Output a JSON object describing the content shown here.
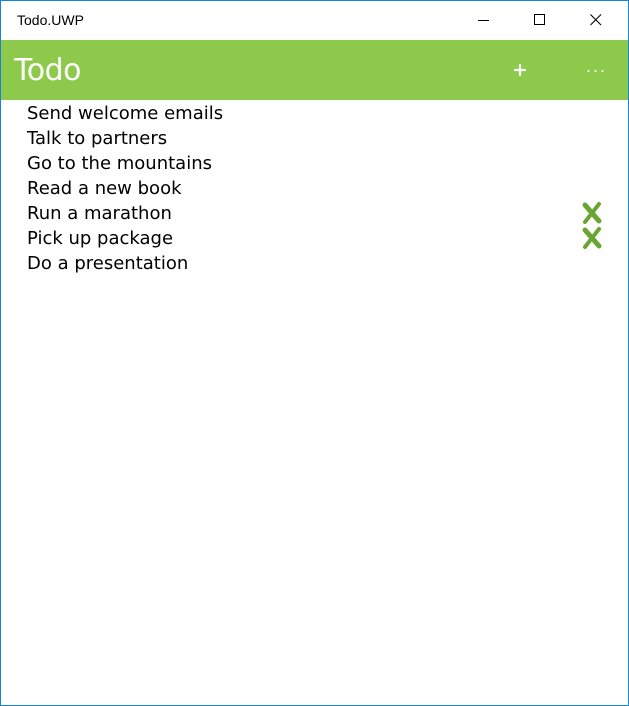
{
  "window": {
    "title": "Todo.UWP",
    "caption_buttons": [
      "minimize-icon",
      "maximize-icon",
      "close-icon"
    ],
    "border_color": "#1883d7"
  },
  "appbar": {
    "title": "Todo",
    "background": "#8dc94a",
    "add_icon": "plus-icon",
    "more_label": "···"
  },
  "todos": [
    {
      "text": "Send welcome emails",
      "done": false
    },
    {
      "text": "Talk to partners",
      "done": false
    },
    {
      "text": "Go to the mountains",
      "done": false
    },
    {
      "text": "Read a new book",
      "done": false
    },
    {
      "text": "Run a marathon",
      "done": true
    },
    {
      "text": "Pick up package",
      "done": true
    },
    {
      "text": "Do a presentation",
      "done": false
    }
  ],
  "colors": {
    "accent": "#8dc94a",
    "done_icon": "#6aa533"
  }
}
